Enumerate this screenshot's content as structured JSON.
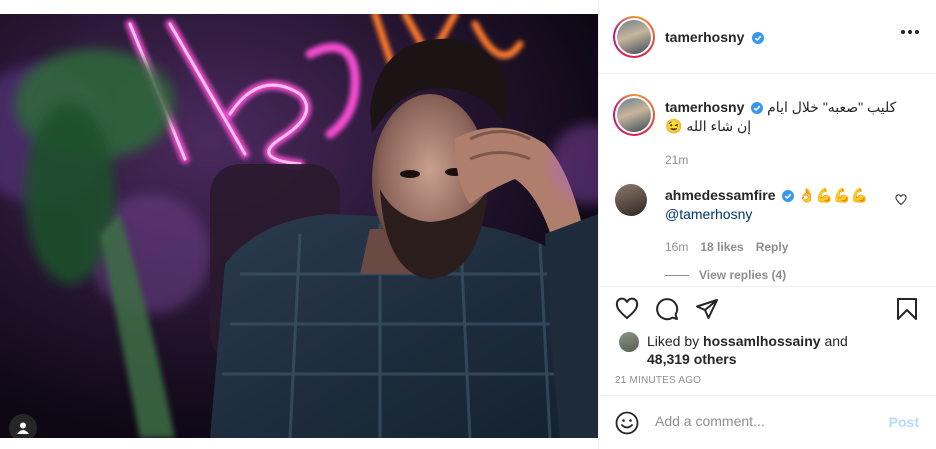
{
  "post": {
    "author": "tamerhosny",
    "caption_arabic_line1": "كليب \"صعبه\" خلال ايام",
    "caption_arabic_line2": "إن شاء الله",
    "caption_emoji": "😉",
    "caption_age": "21m"
  },
  "comment": {
    "author": "ahmedessamfire",
    "emojis": "👌💪💪💪",
    "mention": "@tamerhosny",
    "age": "16m",
    "likes": "18 likes",
    "reply_label": "Reply",
    "view_replies": "View replies (4)"
  },
  "likes": {
    "prefix": "Liked by",
    "user": "hossamlhossainy",
    "and": "and",
    "others": "48,319 others"
  },
  "timestamp": "21 MINUTES AGO",
  "composer": {
    "placeholder": "Add a comment...",
    "post_label": "Post"
  },
  "colors": {
    "verified_blue": "#3897f0",
    "neon_pink": "#ff4fd8",
    "neon_orange": "#ff7a2a",
    "post_disabled": "#b3dbff"
  },
  "icons": [
    "user-tag-icon",
    "verified-badge-icon",
    "more-options-icon",
    "heart-icon",
    "comment-icon",
    "share-icon",
    "bookmark-icon",
    "emoji-icon"
  ]
}
